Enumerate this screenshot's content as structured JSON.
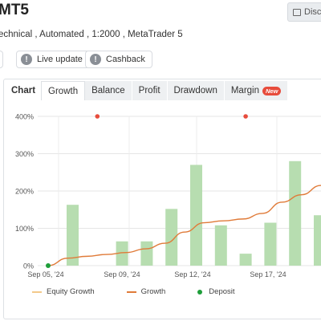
{
  "header": {
    "title": "MT5",
    "discuss_label": "Disc",
    "subtitle": "echnical , Automated , 1:2000 , MetaTrader 5"
  },
  "info_pills": [
    {
      "label": "",
      "icon": "info-icon"
    },
    {
      "label": "Live update",
      "icon": "info-icon"
    },
    {
      "label": "Cashback",
      "icon": "info-icon"
    }
  ],
  "tabs": {
    "heading": "Chart",
    "items": [
      {
        "label": "Growth",
        "active": true
      },
      {
        "label": "Balance",
        "active": false
      },
      {
        "label": "Profit",
        "active": false
      },
      {
        "label": "Drawdown",
        "active": false
      },
      {
        "label": "Margin",
        "active": false,
        "badge": "New"
      }
    ]
  },
  "colors": {
    "bar": "#b7ddb0",
    "growth_line": "#e07b39",
    "equity_line": "#f3c98b",
    "deposit": "#1e9e3a",
    "marker": "#e74c3c"
  },
  "chart_data": {
    "type": "bar",
    "title": "",
    "ylabel": "",
    "xlabel": "",
    "ylim": [
      0,
      400
    ],
    "y_ticks": [
      "400%",
      "300%",
      "200%",
      "100%",
      "0%"
    ],
    "x_ticks": [
      "Sep 05, '24",
      "Sep 09, '24",
      "Sep 12, '24",
      "Sep 17, '24"
    ],
    "bars": [
      163,
      0,
      65,
      65,
      152,
      270,
      108,
      32,
      115,
      280,
      135
    ],
    "growth_line": [
      0,
      20,
      25,
      30,
      35,
      45,
      60,
      90,
      115,
      120,
      125,
      140,
      170,
      190,
      215
    ],
    "markers": [
      1,
      7
    ],
    "legend": [
      "Equity Growth",
      "Growth",
      "Deposit"
    ]
  }
}
